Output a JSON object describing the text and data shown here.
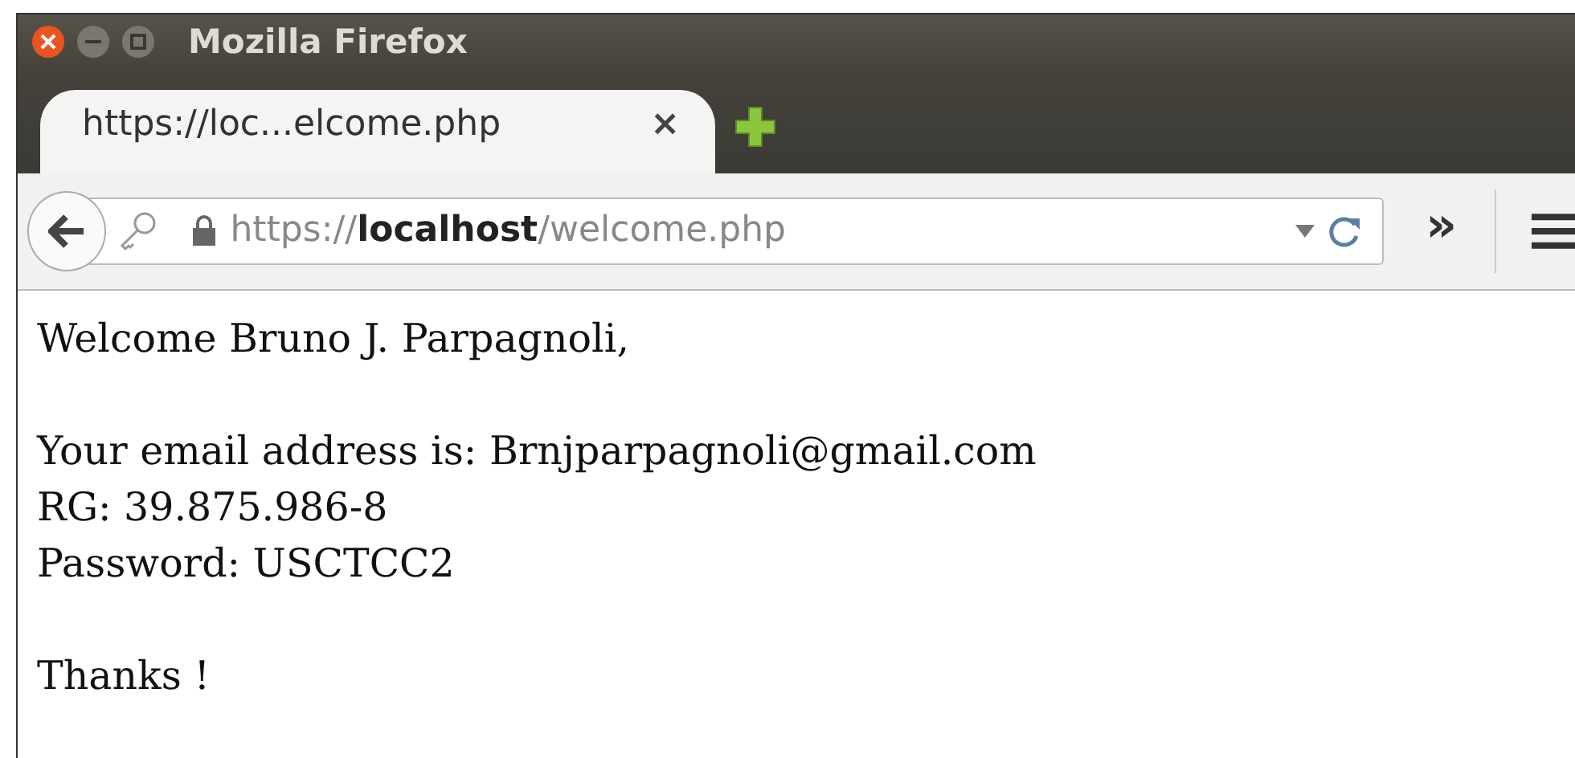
{
  "window": {
    "title": "Mozilla Firefox"
  },
  "tabs": [
    {
      "label": "https://loc...elcome.php",
      "close": "×",
      "selected": true
    }
  ],
  "toolbar": {
    "url": "https://**localhost**/welcome.php",
    "overflow": "»"
  },
  "page": {
    "paragraphs": [
      [
        "Welcome Bruno J. Parpagnoli,"
      ],
      [
        "Your email address is: Brnjparpagnoli@gmail.com",
        "RG: 39.875.986-8",
        "Password: USCTCC2"
      ],
      [
        "Thanks !"
      ]
    ]
  }
}
